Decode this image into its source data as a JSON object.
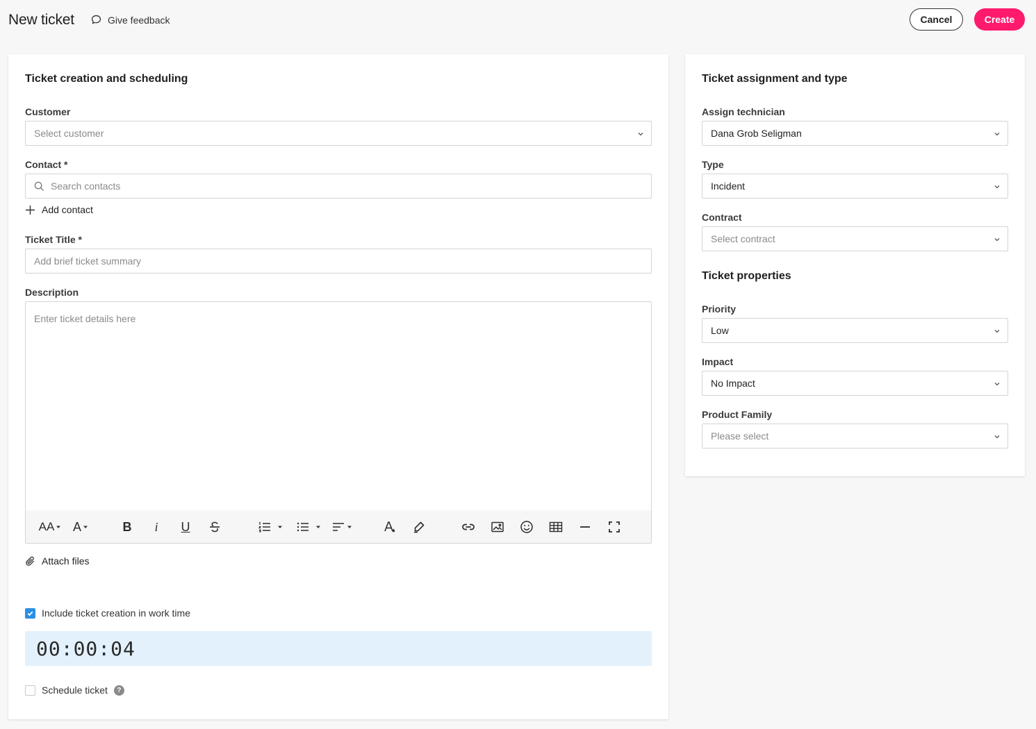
{
  "header": {
    "title": "New ticket",
    "feedback_label": "Give feedback",
    "cancel_label": "Cancel",
    "create_label": "Create"
  },
  "colors": {
    "accent": "#ff1a6e",
    "checkbox": "#2b8fe6",
    "timer_bg": "#e3f1fc"
  },
  "left": {
    "section_title": "Ticket creation and scheduling",
    "customer": {
      "label": "Customer",
      "placeholder": "Select customer"
    },
    "contact": {
      "label": "Contact *",
      "placeholder": "Search contacts",
      "add_label": "Add contact"
    },
    "title": {
      "label": "Ticket Title *",
      "placeholder": "Add brief ticket summary"
    },
    "description": {
      "label": "Description",
      "placeholder": "Enter ticket details here"
    },
    "toolbar": {
      "font_size_label": "AA",
      "font_family_label": "A",
      "bold_label": "B",
      "italic_label": "i",
      "underline_label": "U",
      "icons": [
        "font-size-icon",
        "font-family-icon",
        "bold-icon",
        "italic-icon",
        "underline-icon",
        "strikethrough-icon",
        "ordered-list-icon",
        "unordered-list-icon",
        "align-icon",
        "text-color-icon",
        "highlight-icon",
        "link-icon",
        "image-icon",
        "emoji-icon",
        "table-icon",
        "horizontal-rule-icon",
        "fullscreen-icon"
      ]
    },
    "attach_label": "Attach files",
    "include_worktime": {
      "label": "Include ticket creation in work time",
      "checked": true
    },
    "timer": "00:00:04",
    "schedule": {
      "label": "Schedule ticket",
      "checked": false,
      "help": "?"
    }
  },
  "right": {
    "section_title": "Ticket assignment and type",
    "technician": {
      "label": "Assign technician",
      "value": "Dana Grob Seligman"
    },
    "type": {
      "label": "Type",
      "value": "Incident"
    },
    "contract": {
      "label": "Contract",
      "placeholder": "Select contract"
    },
    "properties_title": "Ticket properties",
    "priority": {
      "label": "Priority",
      "value": "Low"
    },
    "impact": {
      "label": "Impact",
      "value": "No Impact"
    },
    "product_family": {
      "label": "Product Family",
      "placeholder": "Please select"
    }
  }
}
